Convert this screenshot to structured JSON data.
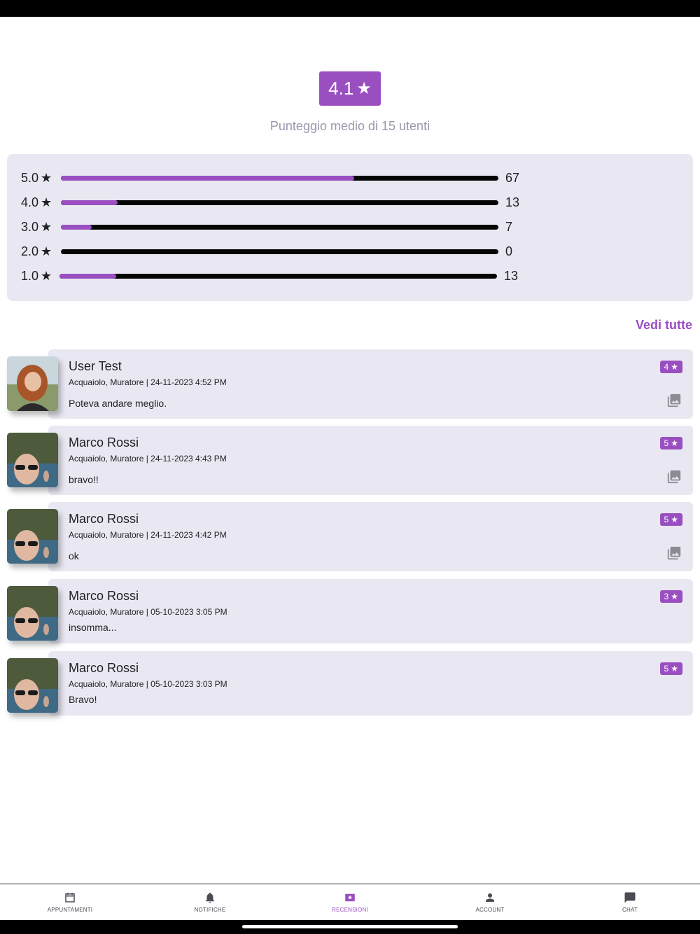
{
  "summary": {
    "score": "4.1",
    "star_glyph": "★",
    "subtitle": "Punteggio medio di 15 utenti"
  },
  "distribution": [
    {
      "label": "5.0",
      "count": "67",
      "fraction": 0.67
    },
    {
      "label": "4.0",
      "count": "13",
      "fraction": 0.13
    },
    {
      "label": "3.0",
      "count": "7",
      "fraction": 0.07
    },
    {
      "label": "2.0",
      "count": "0",
      "fraction": 0.0
    },
    {
      "label": "1.0",
      "count": "13",
      "fraction": 0.13
    }
  ],
  "see_all_label": "Vedi tutte",
  "reviews": [
    {
      "name": "User Test",
      "meta": "Acquaiolo, Muratore  |  24-11-2023 4:52 PM",
      "text": "Poteva andare meglio.",
      "rating": "4",
      "has_images": true
    },
    {
      "name": "Marco Rossi",
      "meta": "Acquaiolo, Muratore  |  24-11-2023 4:43 PM",
      "text": "bravo!!",
      "rating": "5",
      "has_images": true
    },
    {
      "name": "Marco Rossi",
      "meta": "Acquaiolo, Muratore  |  24-11-2023 4:42 PM",
      "text": "ok",
      "rating": "5",
      "has_images": true
    },
    {
      "name": "Marco Rossi",
      "meta": "Acquaiolo, Muratore  |  05-10-2023 3:05 PM",
      "text": "insomma...",
      "rating": "3",
      "has_images": false
    },
    {
      "name": "Marco Rossi",
      "meta": "Acquaiolo, Muratore  |  05-10-2023 3:03 PM",
      "text": "Bravo!",
      "rating": "5",
      "has_images": false
    }
  ],
  "nav": {
    "items": [
      {
        "label": "APPUNTAMENTI",
        "icon": "calendar-icon"
      },
      {
        "label": "NOTIFICHE",
        "icon": "bell-icon"
      },
      {
        "label": "RECENSIONI",
        "icon": "reviews-star-icon"
      },
      {
        "label": "ACCOUNT",
        "icon": "person-icon"
      },
      {
        "label": "CHAT",
        "icon": "chat-icon"
      }
    ],
    "active_index": 2
  },
  "colors": {
    "accent": "#9a4fc1",
    "card_bg": "#e9e8f2",
    "subtitle": "#9a97ac"
  }
}
